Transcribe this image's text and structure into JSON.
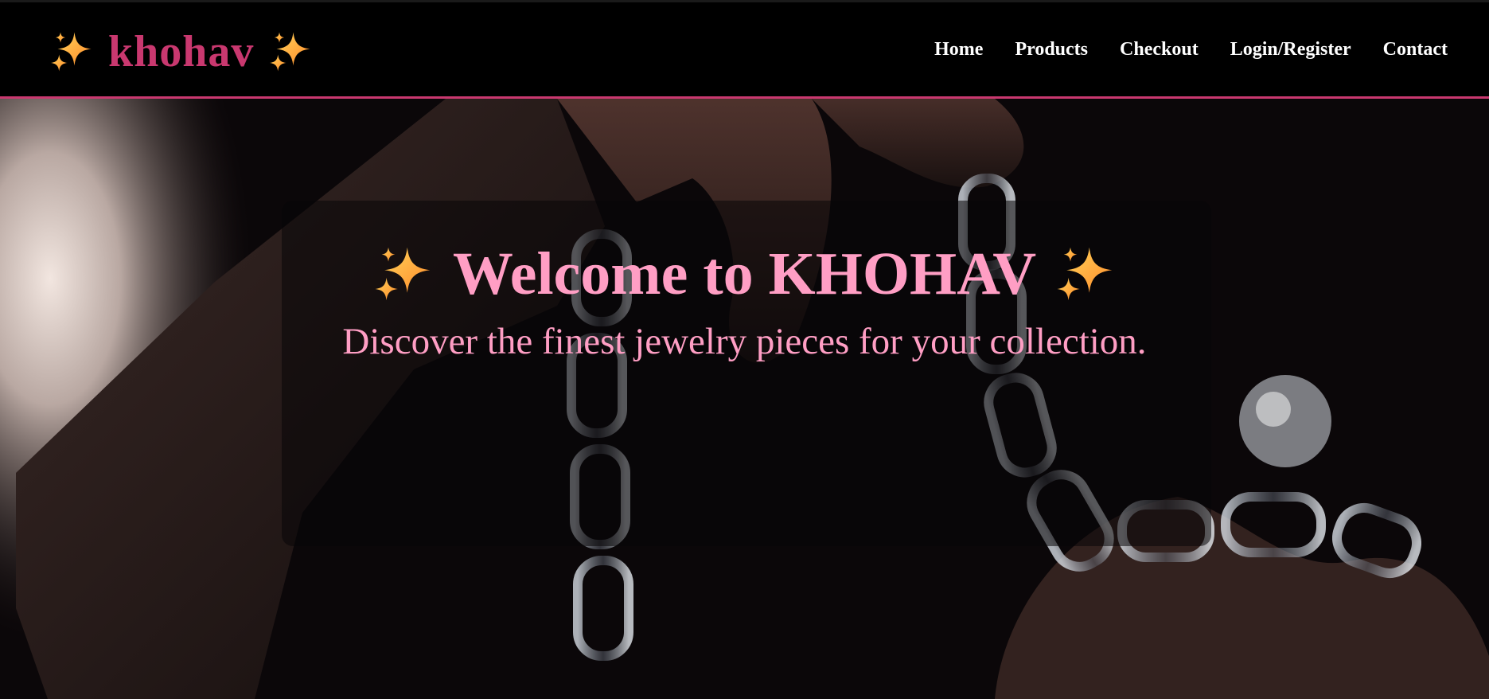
{
  "header": {
    "brand": "khohav",
    "nav": [
      {
        "label": "Home"
      },
      {
        "label": "Products"
      },
      {
        "label": "Checkout"
      },
      {
        "label": "Login/Register"
      },
      {
        "label": "Contact"
      }
    ]
  },
  "hero": {
    "title": "Welcome to KHOHAV",
    "subtitle": "Discover the finest jewelry pieces for your collection.",
    "background_image": "hands holding glass chain links on dark background"
  },
  "icons": {
    "brand_left": "sparkles-icon",
    "brand_right": "sparkles-icon",
    "title_left": "sparkles-icon",
    "title_right": "sparkles-icon"
  },
  "colors": {
    "brand_pink": "#c9386f",
    "hero_text_pink": "#ff9ec4",
    "header_bg": "#000000",
    "nav_text": "#ffffff"
  }
}
